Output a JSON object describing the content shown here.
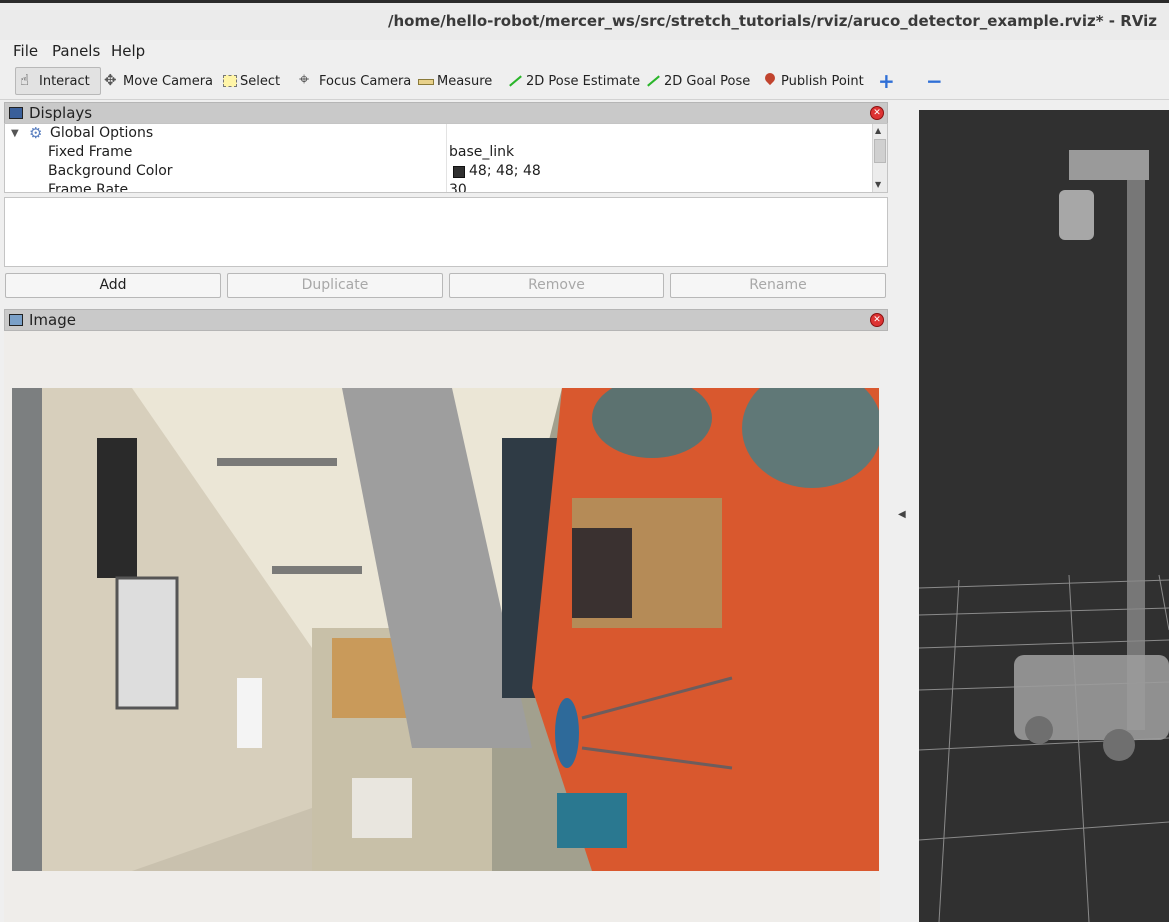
{
  "window": {
    "title": "/home/hello-robot/mercer_ws/src/stretch_tutorials/rviz/aruco_detector_example.rviz* - RViz"
  },
  "menu": {
    "items": [
      {
        "label": "File"
      },
      {
        "label": "Panels"
      },
      {
        "label": "Help"
      }
    ]
  },
  "toolbar": {
    "interact": "Interact",
    "move_camera": "Move Camera",
    "select": "Select",
    "focus_camera": "Focus Camera",
    "measure": "Measure",
    "pose_estimate": "2D Pose Estimate",
    "goal_pose": "2D Goal Pose",
    "publish_point": "Publish Point",
    "add_tool": "+",
    "remove_tool": "−"
  },
  "displays": {
    "title": "Displays",
    "group": "Global Options",
    "properties": [
      {
        "key": "Fixed Frame",
        "value": "base_link"
      },
      {
        "key": "Background Color",
        "value": "48; 48; 48",
        "swatch": "#303030"
      },
      {
        "key": "Frame Rate",
        "value": "30"
      }
    ],
    "buttons": {
      "add": "Add",
      "duplicate": "Duplicate",
      "remove": "Remove",
      "rename": "Rename"
    }
  },
  "image_panel": {
    "title": "Image"
  },
  "colors": {
    "viewport_background": "#303030",
    "floor": "#d9582e",
    "close_button": "#dd3333"
  }
}
